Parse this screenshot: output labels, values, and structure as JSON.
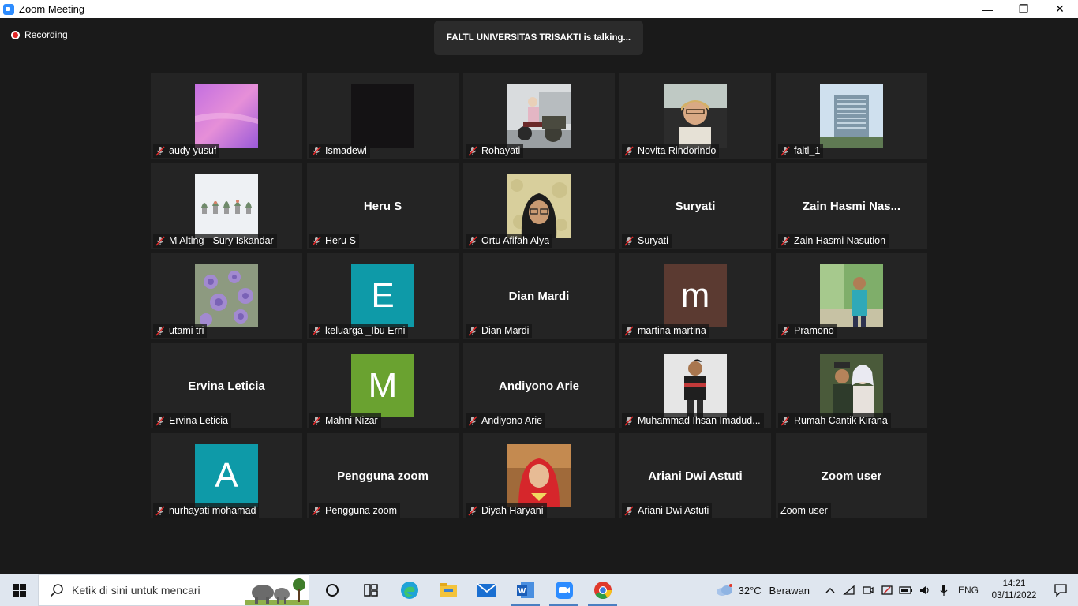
{
  "window": {
    "title": "Zoom Meeting",
    "minimize": "—",
    "maximize": "❐",
    "close": "✕"
  },
  "meeting": {
    "recording_label": "Recording",
    "talking_text": "FALTL UNIVERSITAS TRISAKTI is talking..."
  },
  "participants": [
    {
      "name": "audy yusuf",
      "kind": "photo",
      "photo": "pink-sky-photo",
      "muted": true
    },
    {
      "name": "Ismadewi",
      "kind": "photo",
      "photo": "dark-photo",
      "muted": true
    },
    {
      "name": "Rohayati",
      "kind": "photo",
      "photo": "motorbike-photo",
      "muted": true
    },
    {
      "name": "Novita Rindorindo",
      "kind": "photo",
      "photo": "car-selfie-photo",
      "muted": true
    },
    {
      "name": "faltl_1",
      "kind": "photo",
      "photo": "building-photo",
      "muted": true
    },
    {
      "name": "M Alting - Sury Iskandar",
      "kind": "photo",
      "photo": "plants-photo",
      "muted": true
    },
    {
      "name": "Heru S",
      "kind": "text",
      "display": "Heru S",
      "muted": true
    },
    {
      "name": "Ortu Afifah Alya",
      "kind": "photo",
      "photo": "hijab-portrait-photo",
      "muted": true
    },
    {
      "name": "Suryati",
      "kind": "text",
      "display": "Suryati",
      "muted": true
    },
    {
      "name": "Zain Hasmi Nasution",
      "kind": "text",
      "display": "Zain Hasmi Nas...",
      "muted": true
    },
    {
      "name": "utami tri",
      "kind": "photo",
      "photo": "purple-flowers-photo",
      "muted": true
    },
    {
      "name": "keluarga _Ibu Erni",
      "kind": "letter",
      "letter": "E",
      "color": "#0e9aa8",
      "muted": true
    },
    {
      "name": "Dian Mardi",
      "kind": "text",
      "display": "Dian Mardi",
      "muted": true
    },
    {
      "name": "martina martina",
      "kind": "letter",
      "letter": "m",
      "color": "#5b3a31",
      "muted": true
    },
    {
      "name": "Pramono",
      "kind": "photo",
      "photo": "man-hallway-photo",
      "muted": true
    },
    {
      "name": "Ervina Leticia",
      "kind": "text",
      "display": "Ervina Leticia",
      "muted": true
    },
    {
      "name": "Mahni Nizar",
      "kind": "letter",
      "letter": "M",
      "color": "#6aa230",
      "muted": true
    },
    {
      "name": "Andiyono Arie",
      "kind": "text",
      "display": "Andiyono Arie",
      "muted": true
    },
    {
      "name": "Muhammad Ihsan Imadud...",
      "kind": "photo",
      "photo": "man-jacket-photo",
      "muted": true
    },
    {
      "name": "Rumah Cantik Kirana",
      "kind": "photo",
      "photo": "couple-photo",
      "muted": true
    },
    {
      "name": "nurhayati mohamad",
      "kind": "letter",
      "letter": "A",
      "color": "#0e9aa8",
      "muted": true
    },
    {
      "name": "Pengguna zoom",
      "kind": "text",
      "display": "Pengguna zoom",
      "muted": true
    },
    {
      "name": "Diyah Haryani",
      "kind": "photo",
      "photo": "red-hijab-photo",
      "muted": true
    },
    {
      "name": "Ariani Dwi Astuti",
      "kind": "text",
      "display": "Ariani Dwi Astuti",
      "muted": true
    },
    {
      "name": "Zoom user",
      "kind": "text",
      "display": "Zoom user",
      "muted": false
    }
  ],
  "taskbar": {
    "search_placeholder": "Ketik di sini untuk mencari",
    "apps": [
      "task-view-icon",
      "cortana-icon",
      "edge-icon",
      "file-explorer-icon",
      "mail-icon",
      "word-icon",
      "zoom-icon",
      "chrome-icon"
    ],
    "weather_temp": "32°C",
    "weather_cond": "Berawan",
    "language": "ENG",
    "time": "14:21",
    "date": "03/11/2022"
  },
  "colors": {
    "accent": "#2d8cff",
    "muted_mic": "#e02828",
    "tile_bg": "#242424",
    "taskbar_bg": "#dfe6ef"
  }
}
